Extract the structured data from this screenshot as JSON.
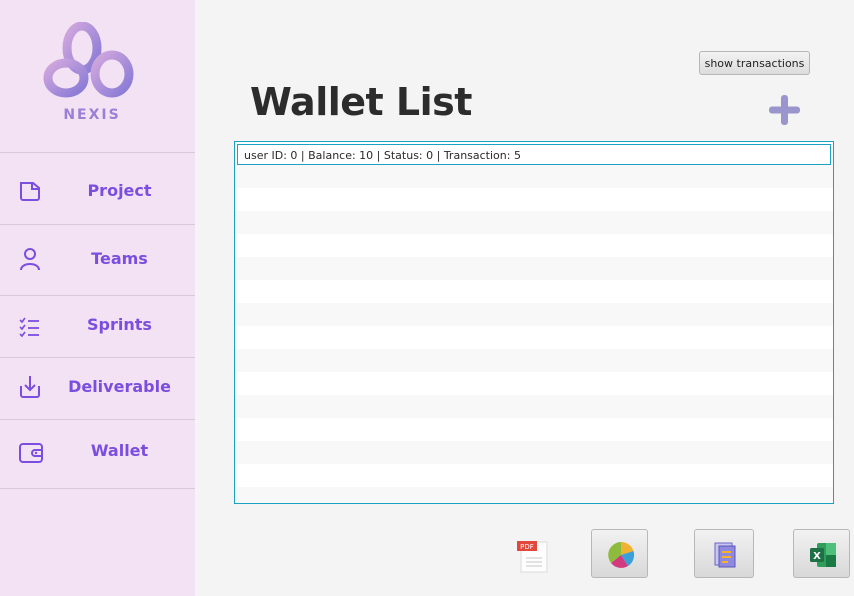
{
  "brand": {
    "name": "NEXIS",
    "logo_gradient": [
      "#c9a0dc",
      "#8a7ad8"
    ]
  },
  "sidebar": {
    "items": [
      {
        "label": "Project",
        "icon": "folder-icon"
      },
      {
        "label": "Teams",
        "icon": "user-icon"
      },
      {
        "label": "Sprints",
        "icon": "checklist-icon"
      },
      {
        "label": "Deliverable",
        "icon": "download-tray-icon"
      },
      {
        "label": "Wallet",
        "icon": "wallet-icon"
      }
    ],
    "accent_color": "#7b4ee0"
  },
  "main": {
    "title": "Wallet List",
    "show_transactions_label": "show transactions",
    "add_icon": "plus-icon",
    "list": {
      "items": [
        "user ID: 0 | Balance: 10 | Status: 0 | Transaction: 5"
      ],
      "selected_index": 0,
      "border_color": "#1ba1c4"
    },
    "actions": [
      {
        "name": "pdf-export",
        "icon": "pdf-icon",
        "badge": "PDF"
      },
      {
        "name": "statistics",
        "icon": "pie-chart-icon"
      },
      {
        "name": "report",
        "icon": "document-icon"
      },
      {
        "name": "excel-export",
        "icon": "excel-icon",
        "badge": "X"
      }
    ]
  }
}
